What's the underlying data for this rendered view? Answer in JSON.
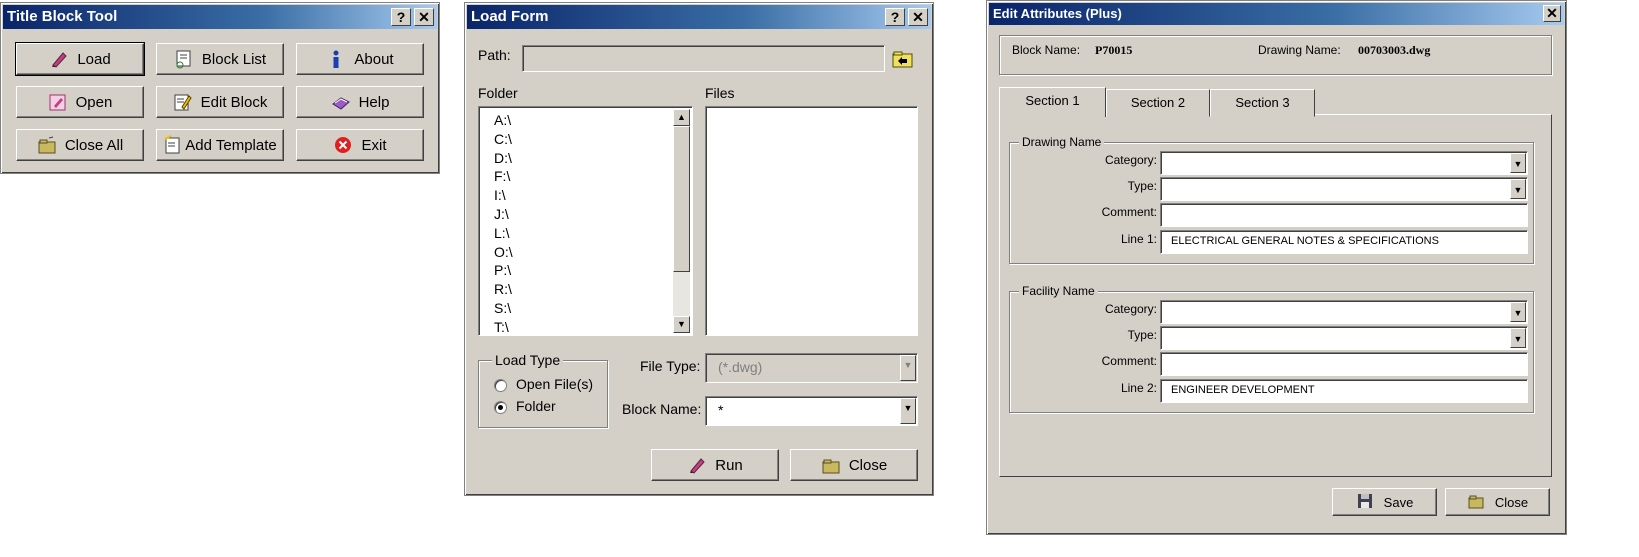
{
  "title_block_tool": {
    "title": "Title Block Tool",
    "help_btn": "?",
    "close_btn": "✕",
    "buttons": {
      "load": "Load",
      "block_list": "Block List",
      "about": "About",
      "open": "Open",
      "edit_block": "Edit Block",
      "help": "Help",
      "close_all": "Close All",
      "add_template": "Add Template",
      "exit": "Exit"
    }
  },
  "load_form": {
    "title": "Load Form",
    "help_btn": "?",
    "close_btn": "✕",
    "path_label": "Path:",
    "path_value": "",
    "folder_label": "Folder",
    "files_label": "Files",
    "folders": [
      "A:\\",
      "C:\\",
      "D:\\",
      "F:\\",
      "I:\\",
      "J:\\",
      "L:\\",
      "O:\\",
      "P:\\",
      "R:\\",
      "S:\\",
      "T:\\"
    ],
    "load_type_label": "Load Type",
    "option_open_files": "Open File(s)",
    "option_folder": "Folder",
    "file_type_label": "File Type:",
    "file_type_value": "(*.dwg)",
    "block_name_label": "Block Name:",
    "block_name_value": "*",
    "run_btn": "Run",
    "close_btn_label": "Close"
  },
  "edit_attributes": {
    "title": "Edit Attributes (Plus)",
    "close_btn": "✕",
    "block_name_label": "Block Name:",
    "block_name_value": "P70015",
    "drawing_name_label": "Drawing Name:",
    "drawing_name_value": "00703003.dwg",
    "tabs": [
      "Section 1",
      "Section 2",
      "Section 3"
    ],
    "drawing_group": {
      "title": "Drawing Name",
      "category_label": "Category:",
      "type_label": "Type:",
      "comment_label": "Comment:",
      "line_label": "Line 1:",
      "line_value": "ELECTRICAL GENERAL NOTES & SPECIFICATIONS"
    },
    "facility_group": {
      "title": "Facility Name",
      "category_label": "Category:",
      "type_label": "Type:",
      "comment_label": "Comment:",
      "line_label": "Line 2:",
      "line_value": "ENGINEER DEVELOPMENT"
    },
    "save_btn": "Save",
    "close_btn_label": "Close"
  }
}
